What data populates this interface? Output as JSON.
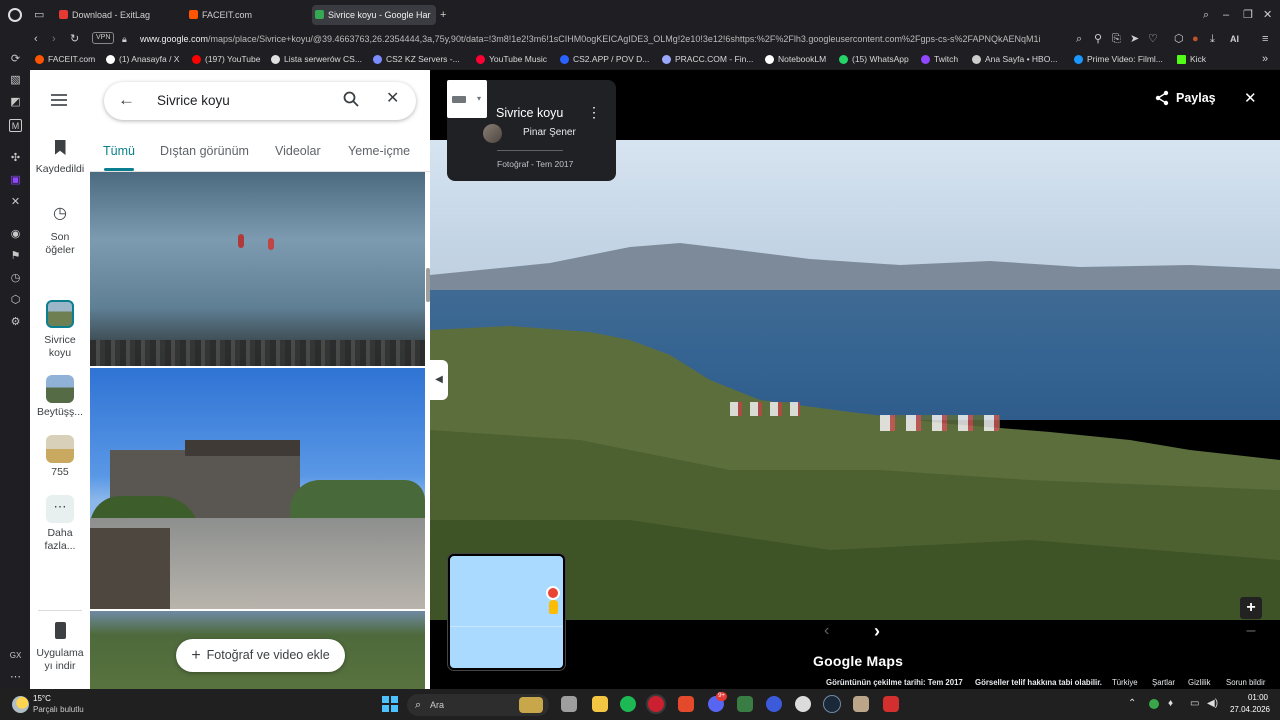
{
  "browser": {
    "tabs": [
      {
        "label": "Download - ExitLag",
        "color": "#e53935"
      },
      {
        "label": "FACEIT.com",
        "color": "#ff5500"
      },
      {
        "label": "Sivrice koyu - Google Har",
        "color": "#34a853"
      }
    ],
    "vpn": "VPN",
    "url_host": "www.google.com",
    "url_path": "/maps/place/Sivrice+koyu/@39.4663763,26.2354444,3a,75y,90t/data=!3m8!1e2!3m6!1sCIHM0ogKEICAgIDE3_OLMg!2e10!3e12!6shttps:%2F%2Flh3.googleusercontent.com%2Fgps-cs-s%2FAPNQkAENqM1i",
    "ai_label": "AI"
  },
  "bookmarks": [
    {
      "label": "FACEIT.com",
      "color": "#ff5500"
    },
    {
      "label": "(1) Anasayfa / X",
      "color": "#ffffff"
    },
    {
      "label": "(197) YouTube",
      "color": "#ff0000"
    },
    {
      "label": "Lista serwerów CS...",
      "color": "#e0e0e0"
    },
    {
      "label": "CS2 KZ Servers -...",
      "color": "#7b8cff"
    },
    {
      "label": "YouTube Music",
      "color": "#ff0033"
    },
    {
      "label": "CS2.APP / POV D...",
      "color": "#2962ff"
    },
    {
      "label": "PRACC.COM - Fin...",
      "color": "#9aa8ff"
    },
    {
      "label": "NotebookLM",
      "color": "#ffffff"
    },
    {
      "label": "(15) WhatsApp",
      "color": "#25d366"
    },
    {
      "label": "Twitch",
      "color": "#9146ff"
    },
    {
      "label": "Ana Sayfa • HBO...",
      "color": "#cccccc"
    },
    {
      "label": "Prime Video: Filml...",
      "color": "#1a98ff"
    },
    {
      "label": "Kick",
      "color": "#53fc18"
    }
  ],
  "rail": {
    "gx_label": "GX"
  },
  "maps_nav": {
    "saved": "Kaydedildi",
    "recent_line1": "Son",
    "recent_line2": "öğeler",
    "place1_line1": "Sivrice",
    "place1_line2": "koyu",
    "place2": "Beytüşş...",
    "place3": "755",
    "more_line1": "Daha",
    "more_line2": "fazla...",
    "app_line1": "Uygulama",
    "app_line2": "yı indir"
  },
  "panel": {
    "search_value": "Sivrice koyu",
    "tabs": [
      "Tümü",
      "Dıştan görünüm",
      "Videolar",
      "Yeme-içme"
    ],
    "add_photo": "Fotoğraf ve video ekle"
  },
  "viewer": {
    "title": "Sivrice koyu",
    "author": "Pinar Şener",
    "date": "Fotoğraf - Tem 2017",
    "share": "Paylaş",
    "logo": "Google Maps",
    "capture_date": "Görüntünün çekilme tarihi: Tem 2017",
    "copyright": "Görseller telif hakkına tabi olabilir.",
    "links": [
      "Türkiye",
      "Şartlar",
      "Gizlilik",
      "Sorun bildir"
    ]
  },
  "taskbar": {
    "temp": "15°C",
    "weather": "Parçalı bulutlu",
    "search": "Ara",
    "time": "01:00",
    "date": "27.04.2026",
    "discord_badge": "9+"
  }
}
